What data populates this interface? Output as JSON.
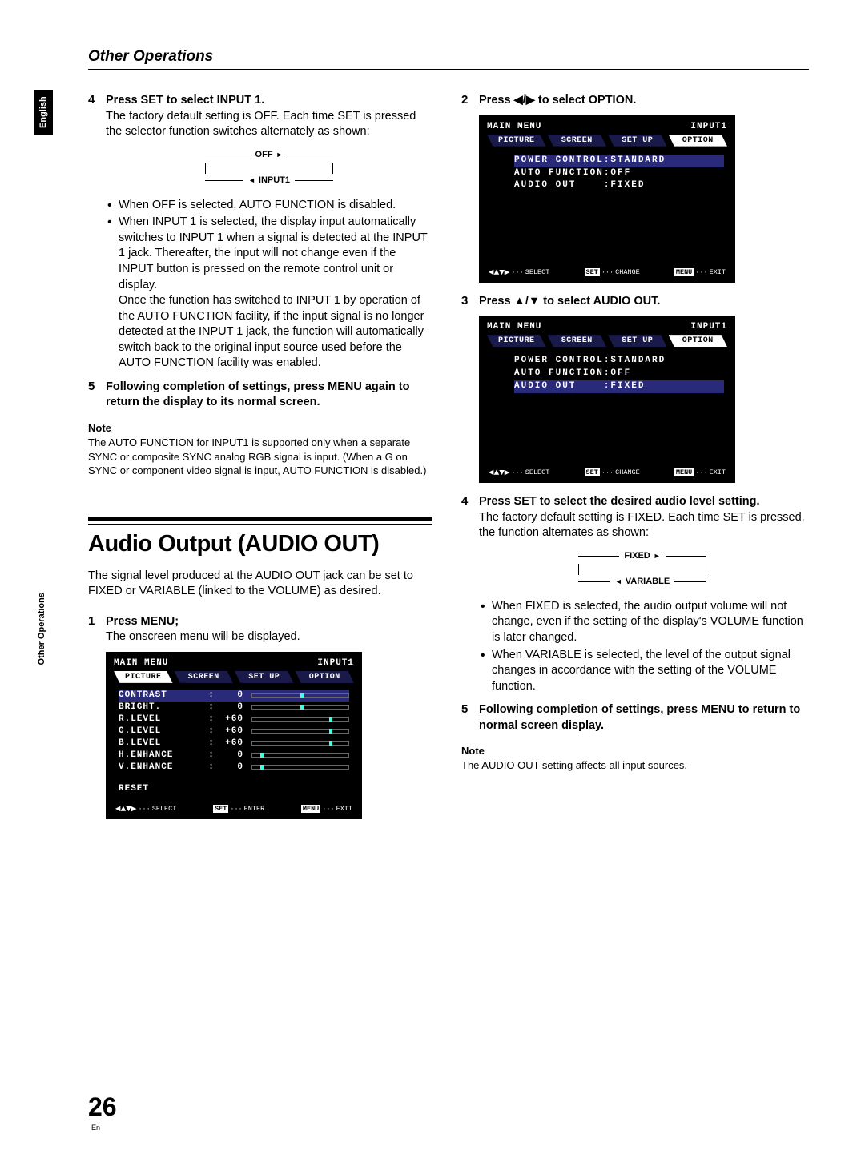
{
  "lang_tab": "English",
  "side_label": "Other Operations",
  "section_title": "Other Operations",
  "page_number": "26",
  "page_number_sub": "En",
  "left": {
    "step4_head": "Press SET to select INPUT 1.",
    "step4_body": "The factory default setting is OFF. Each time SET is pressed the selector function switches alternately as shown:",
    "toggle_top": "OFF",
    "toggle_bottom": "INPUT1",
    "bullet1": "When OFF is selected, AUTO FUNCTION is disabled.",
    "bullet2": "When INPUT 1 is selected, the display input automatically switches to INPUT 1 when a signal is detected at the INPUT 1 jack. Thereafter, the input will not change even if the INPUT button is pressed on the remote control unit or display.\nOnce the function has switched to INPUT 1 by operation of the AUTO FUNCTION facility, if the input signal is no longer detected at the INPUT 1 jack, the function will automatically switch back to the original input source used before the AUTO FUNCTION facility was enabled.",
    "step5_head": "Following completion of settings, press MENU again to return the display to its normal screen.",
    "note_head": "Note",
    "note_body": "The AUTO FUNCTION for INPUT1 is supported only when a separate SYNC or composite SYNC analog RGB signal is input. (When a G on SYNC or component video signal is input, AUTO FUNCTION is disabled.)",
    "audio_title": "Audio Output (AUDIO OUT)",
    "audio_intro": "The signal level produced at the AUDIO OUT jack can be set to FIXED or VARIABLE (linked to the VOLUME) as desired.",
    "step1_head": "Press MENU;",
    "step1_body": "The onscreen menu will be displayed."
  },
  "right": {
    "step2_head": "Press ◀/▶ to select OPTION.",
    "step3_head": "Press ▲/▼ to select AUDIO OUT.",
    "step4_head": "Press SET to select the desired audio level setting.",
    "step4_body": "The factory default setting is FIXED. Each time SET is pressed, the function alternates as shown:",
    "toggle_top": "FIXED",
    "toggle_bottom": "VARIABLE",
    "bullet1": "When FIXED is selected, the audio output volume will not change, even if the setting of the display's VOLUME function is later changed.",
    "bullet2": "When VARIABLE is selected, the level of the output signal changes in accordance with the setting of the VOLUME function.",
    "step5_head": "Following completion of settings, press MENU to return to normal screen display.",
    "note_head": "Note",
    "note_body": "The AUDIO OUT setting affects all input sources."
  },
  "osd_common": {
    "title": "MAIN MENU",
    "input": "INPUT1",
    "tabs": [
      "PICTURE",
      "SCREEN",
      "SET UP",
      "OPTION"
    ],
    "foot_select": "SELECT",
    "foot_set": "SET",
    "foot_menu": "MENU",
    "foot_enter": "ENTER",
    "foot_change": "CHANGE",
    "foot_exit": "EXIT"
  },
  "osd_picture": {
    "rows": [
      {
        "k": "CONTRAST",
        "v": "0",
        "tick": 50,
        "hl": true
      },
      {
        "k": "BRIGHT.",
        "v": "0",
        "tick": 50
      },
      {
        "k": "R.LEVEL",
        "v": "+60",
        "tick": 80
      },
      {
        "k": "G.LEVEL",
        "v": "+60",
        "tick": 80
      },
      {
        "k": "B.LEVEL",
        "v": "+60",
        "tick": 80
      },
      {
        "k": "H.ENHANCE",
        "v": "0",
        "tick": 8
      },
      {
        "k": "V.ENHANCE",
        "v": "0",
        "tick": 8
      }
    ],
    "reset": "RESET"
  },
  "osd_option": {
    "line1": "POWER CONTROL:STANDARD",
    "line2": "AUTO FUNCTION:OFF",
    "line3": "AUDIO OUT    :FIXED"
  }
}
